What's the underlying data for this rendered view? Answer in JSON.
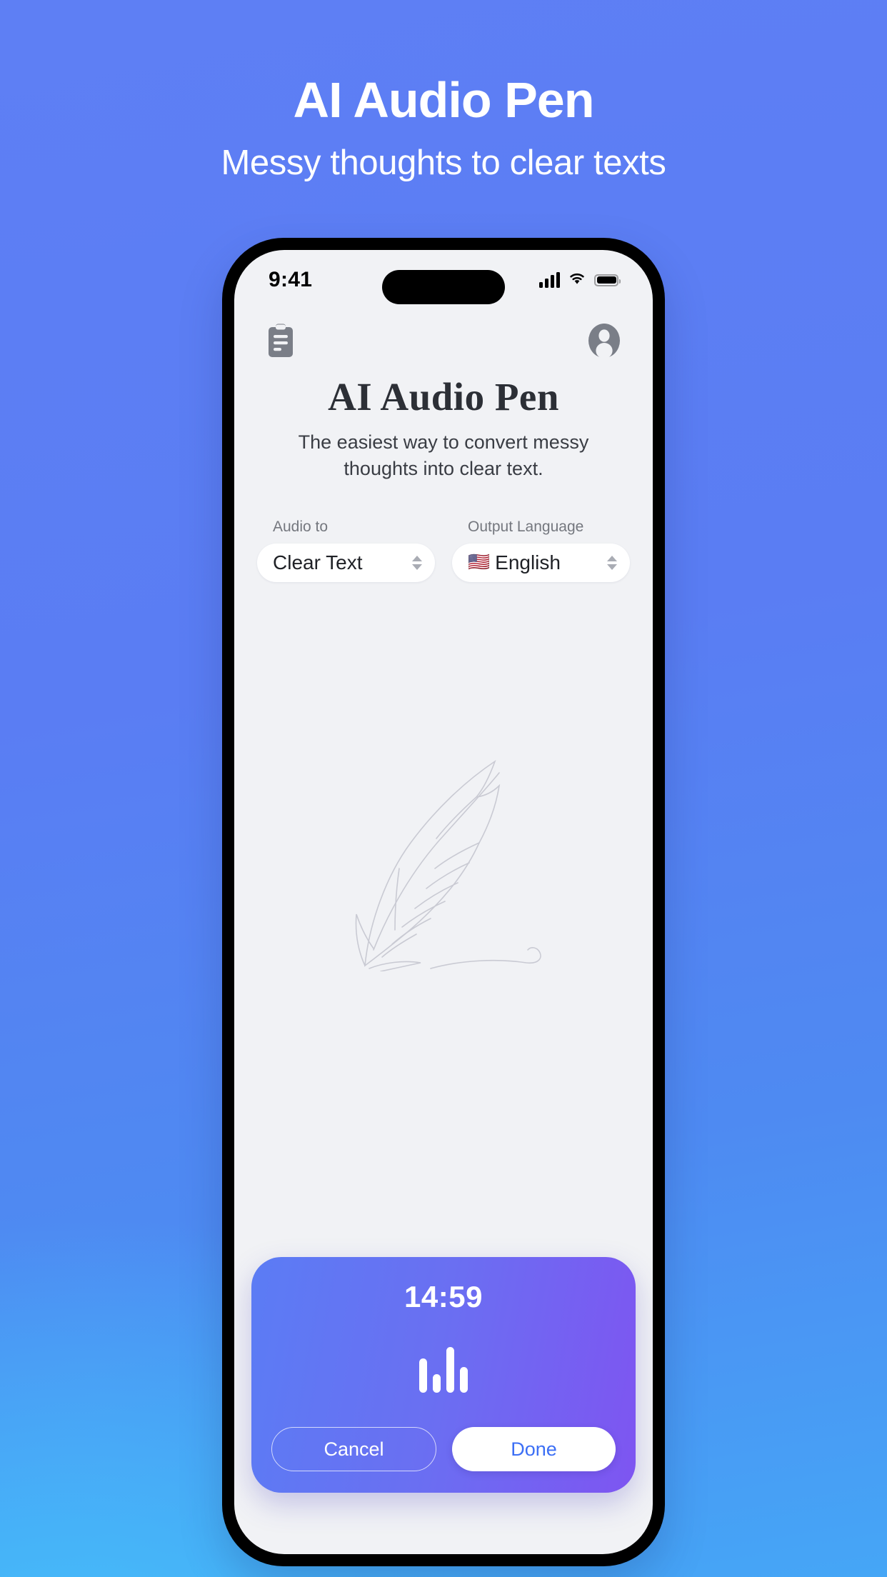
{
  "promo": {
    "title": "AI Audio Pen",
    "subtitle": "Messy thoughts to clear texts"
  },
  "theme": {
    "bg_top": "#5E7FF4",
    "bg_bottom_left": "#45BFFA",
    "panel_from": "#5B7CF4",
    "panel_to": "#7E55F1",
    "screen_bg": "#F1F2F5",
    "accent_blue": "#3C6FF5",
    "icon_gray": "#7A7E87"
  },
  "status_bar": {
    "time": "9:41",
    "signal_icon": "cellular-bars-icon",
    "wifi_icon": "wifi-icon",
    "battery_icon": "battery-full-icon",
    "island": "dynamic-island"
  },
  "app_header": {
    "left_icon": "clipboard-icon",
    "right_icon": "account-avatar-icon"
  },
  "app": {
    "title": "AI Audio Pen",
    "description": "The easiest way to convert messy thoughts into clear text."
  },
  "selects": [
    {
      "label": "Audio to",
      "value": "Clear Text",
      "flag": "",
      "stepper_icon": "stepper-updown-icon"
    },
    {
      "label": "Output Language",
      "value": "English",
      "flag": "🇺🇸",
      "stepper_icon": "stepper-updown-icon"
    }
  ],
  "watermark": {
    "icon": "quill-feather-icon"
  },
  "recorder": {
    "elapsed": "14:59",
    "waveform_icon": "audio-waveform-icon",
    "cancel_label": "Cancel",
    "done_label": "Done"
  }
}
